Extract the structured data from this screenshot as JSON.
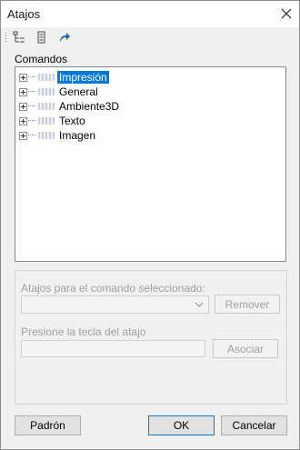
{
  "window": {
    "title": "Atajos"
  },
  "toolbar": {
    "buttons": [
      {
        "icon": "tree-expand-icon"
      },
      {
        "icon": "list-view-icon"
      },
      {
        "icon": "shortcut-arrow-icon"
      }
    ]
  },
  "commands": {
    "label": "Comandos",
    "items": [
      {
        "label": "Impresión",
        "selected": true
      },
      {
        "label": "General",
        "selected": false
      },
      {
        "label": "Ambiente3D",
        "selected": false
      },
      {
        "label": "Texto",
        "selected": false
      },
      {
        "label": "Imagen",
        "selected": false
      }
    ]
  },
  "shortcut_group": {
    "selected_command_label": "Atajos para el comando seleccionado:",
    "combo_value": "",
    "remove_label": "Remover",
    "press_key_label": "Presione la tecla del atajo",
    "key_value": "",
    "assign_label": "Asociar"
  },
  "footer": {
    "default_label": "Padrón",
    "ok_label": "OK",
    "cancel_label": "Cancelar"
  },
  "colors": {
    "selection": "#0078d7"
  }
}
